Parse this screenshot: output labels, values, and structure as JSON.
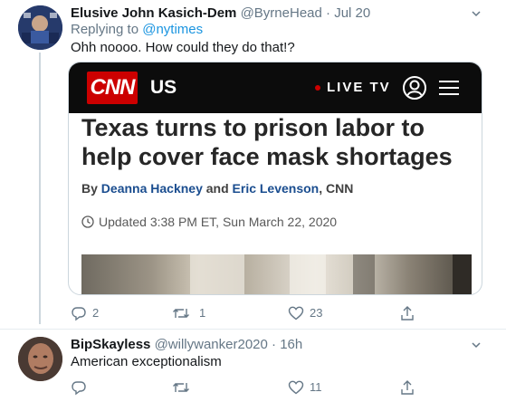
{
  "tweet1": {
    "author_name": "Elusive John Kasich-Dem",
    "handle": "@ByrneHead",
    "separator": "·",
    "date": "Jul 20",
    "replying_prefix": "Replying to",
    "replying_handle": "@nytimes",
    "text": "Ohh noooo. How could they do that!?",
    "card": {
      "logo": "CNN",
      "section": "US",
      "live_label": "LIVE TV",
      "headline": "Texas turns to prison labor to help cover face mask shortages",
      "byline_prefix": "By",
      "author1": "Deanna Hackney",
      "byline_and": "and",
      "author2": "Eric Levenson",
      "byline_suffix": ", CNN",
      "updated": "Updated 3:38 PM ET, Sun March 22, 2020"
    },
    "actions": {
      "replies": "2",
      "retweets": "1",
      "likes": "23"
    }
  },
  "tweet2": {
    "author_name": "BipSkayless",
    "handle": "@willywanker2020",
    "separator": "·",
    "date": "16h",
    "text": "American exceptionalism",
    "actions": {
      "replies": "",
      "retweets": "",
      "likes": "11"
    }
  },
  "colors": {
    "link": "#1b95e0",
    "muted": "#657786",
    "cnn_red": "#cc0000",
    "border": "#e6ecf0"
  }
}
